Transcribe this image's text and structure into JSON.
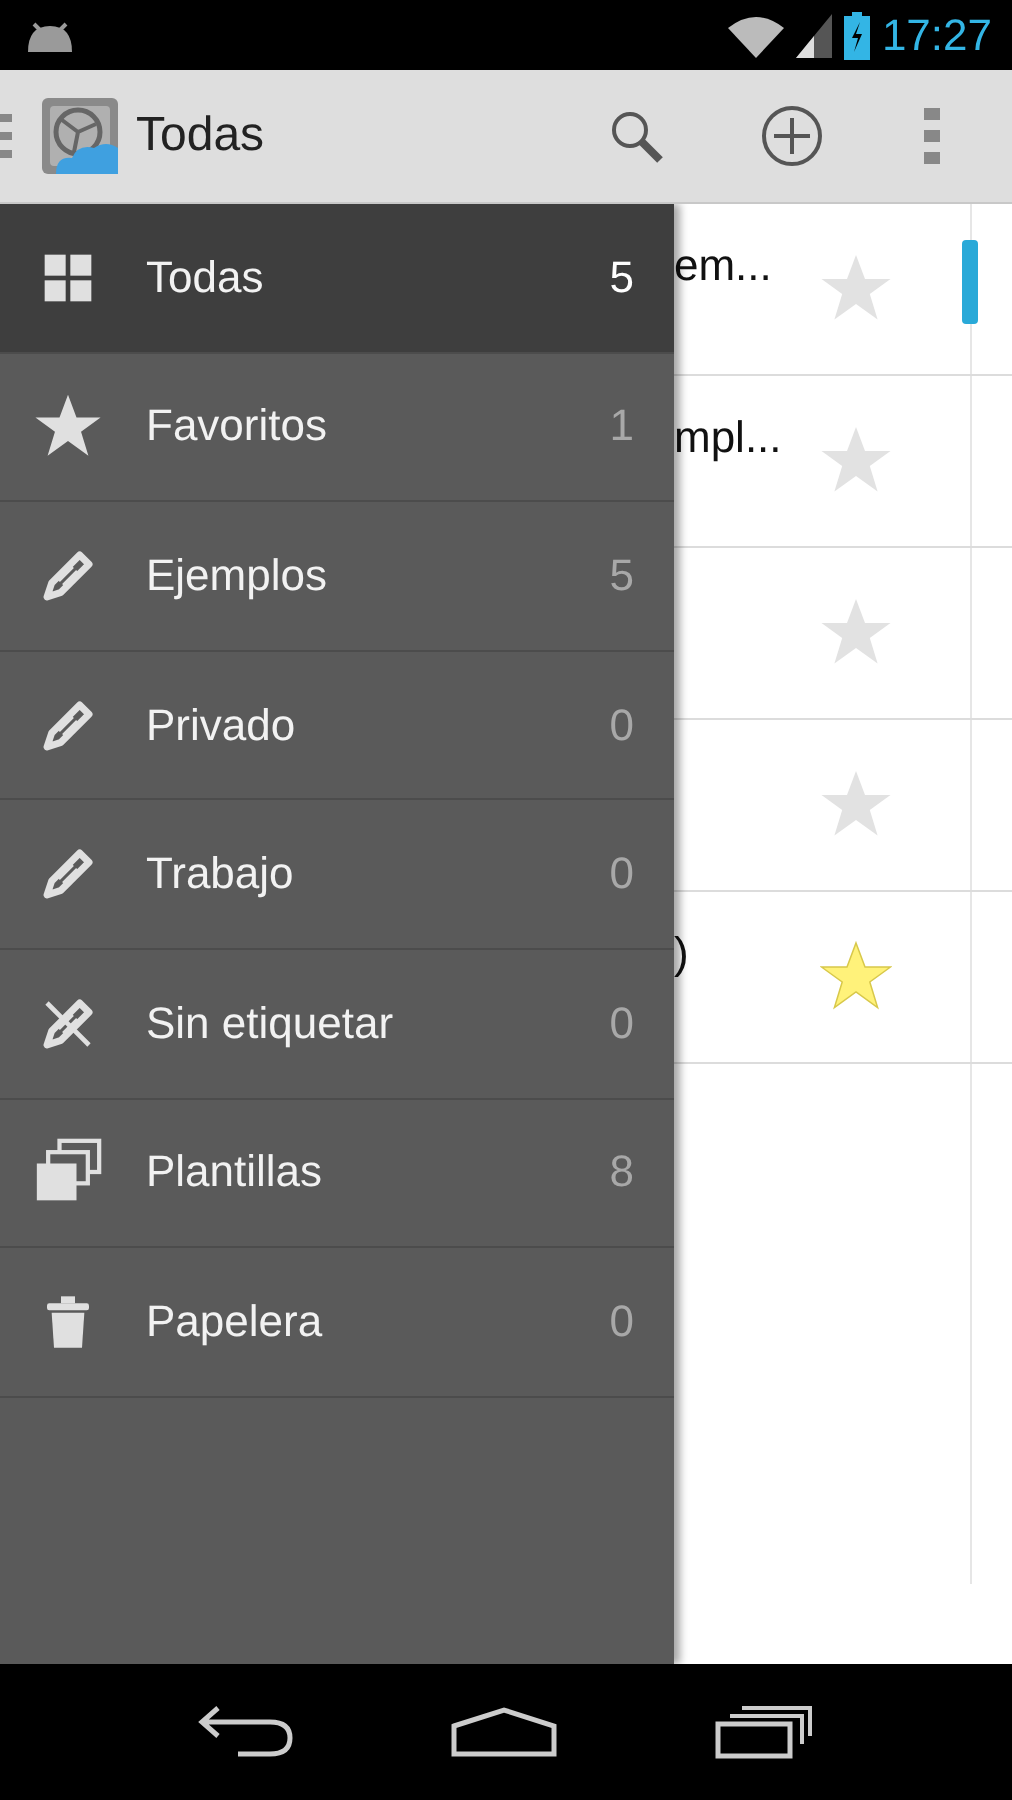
{
  "status_bar": {
    "time": "17:27"
  },
  "action_bar": {
    "title": "Todas"
  },
  "notes": [
    {
      "text": "em...",
      "favorite": false,
      "color": "#29a9d8"
    },
    {
      "text": "mpl...",
      "favorite": false
    },
    {
      "favorite": false
    },
    {
      "favorite": false
    },
    {
      "text": ")",
      "favorite": true
    }
  ],
  "drawer": {
    "items": [
      {
        "kind": "all",
        "label": "Todas",
        "count": "5",
        "selected": true
      },
      {
        "kind": "favorites",
        "label": "Favoritos",
        "count": "1",
        "selected": false
      },
      {
        "kind": "tag",
        "label": "Ejemplos",
        "count": "5",
        "selected": false
      },
      {
        "kind": "tag",
        "label": "Privado",
        "count": "0",
        "selected": false
      },
      {
        "kind": "tag",
        "label": "Trabajo",
        "count": "0",
        "selected": false
      },
      {
        "kind": "untagged",
        "label": "Sin etiquetar",
        "count": "0",
        "selected": false
      },
      {
        "kind": "templates",
        "label": "Plantillas",
        "count": "8",
        "selected": false
      },
      {
        "kind": "trash",
        "label": "Papelera",
        "count": "0",
        "selected": false
      }
    ]
  }
}
